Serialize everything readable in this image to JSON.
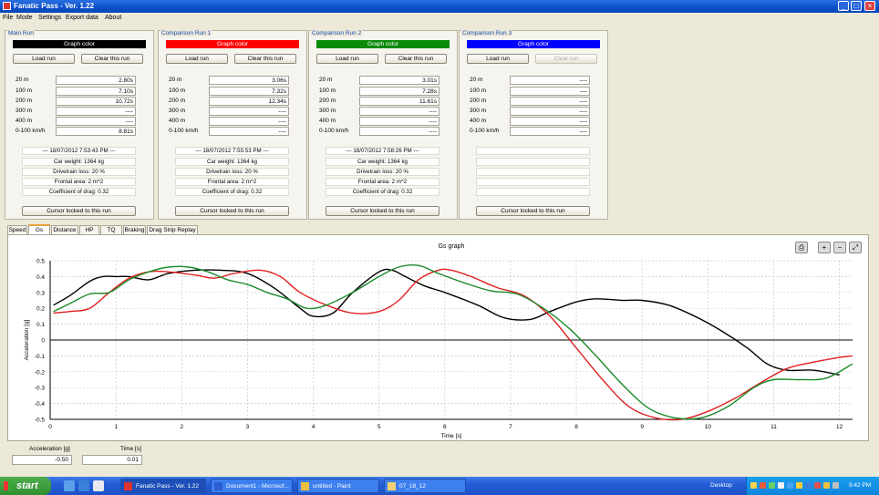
{
  "window": {
    "title": "Fanatic Pass - Ver. 1.22"
  },
  "menu": [
    "File",
    "Mode",
    "Settings",
    "Export data",
    "About"
  ],
  "row_labels": [
    "20 m",
    "100 m",
    "200 m",
    "300 m",
    "400 m",
    "0-100 km/h"
  ],
  "panels": [
    {
      "title": "Main Run",
      "color_label": "Graph color",
      "color": "#000000",
      "load_label": "Load run",
      "clear_label": "Clear this run",
      "clear_enabled": true,
      "values": [
        "2.80s",
        "7.10s",
        "10.72s",
        "----",
        "----",
        "8.81s"
      ],
      "info": [
        "--- 18/07/2012 7:53:43 PM ---",
        "Car weight: 1364 kg",
        "Drivetrain loss: 20 %",
        "Frontal area: 2 m^2",
        "Coefficient of drag: 0.32"
      ],
      "cursor_label": "Cursor locked to this run"
    },
    {
      "title": "Comparison Run 1",
      "color_label": "Graph color",
      "color": "#ff0000",
      "load_label": "Load run",
      "clear_label": "Clear this run",
      "clear_enabled": true,
      "values": [
        "3.06s",
        "7.32s",
        "12.34s",
        "----",
        "----",
        "----"
      ],
      "info": [
        "--- 18/07/2012 7:55:53 PM ---",
        "Car weight: 1364 kg",
        "Drivetrain loss: 20 %",
        "Frontal area: 2 m^2",
        "Coefficient of drag: 0.32"
      ],
      "cursor_label": "Cursor locked to this run"
    },
    {
      "title": "Comparison Run 2",
      "color_label": "Graph color",
      "color": "#0a8a0a",
      "load_label": "Load run",
      "clear_label": "Clear this run",
      "clear_enabled": true,
      "values": [
        "3.01s",
        "7.28s",
        "11.61s",
        "----",
        "----",
        "----"
      ],
      "info": [
        "--- 18/07/2012 7:58:26 PM ---",
        "Car weight: 1364 kg",
        "Drivetrain loss: 20 %",
        "Frontal area: 2 m^2",
        "Coefficient of drag: 0.32"
      ],
      "cursor_label": "Cursor locked to this run"
    },
    {
      "title": "Comparison Run 3",
      "color_label": "Graph color",
      "color": "#0000ff",
      "load_label": "Load run",
      "clear_label": "Clear run",
      "clear_enabled": false,
      "values": [
        "----",
        "----",
        "----",
        "----",
        "----",
        "----"
      ],
      "info": [
        "",
        "",
        "",
        "",
        ""
      ],
      "cursor_label": "Cursor locked to this run"
    }
  ],
  "tabs": [
    {
      "label": "Speed",
      "active": false
    },
    {
      "label": "Gs",
      "active": true
    },
    {
      "label": "Distance",
      "active": false
    },
    {
      "label": "HP",
      "active": false
    },
    {
      "label": "TQ",
      "active": false
    },
    {
      "label": "Braking",
      "active": false
    },
    {
      "label": "Drag Strip Replay",
      "active": false
    }
  ],
  "chart_data": {
    "type": "line",
    "title": "Gs graph",
    "xlabel": "Time [s]",
    "ylabel": "Acceleration [g]",
    "xlim": [
      0,
      12.2
    ],
    "ylim": [
      -0.5,
      0.5
    ],
    "x_ticks": [
      0,
      1,
      2,
      3,
      4,
      5,
      6,
      7,
      8,
      9,
      10,
      11,
      12
    ],
    "y_ticks": [
      0.5,
      0.4,
      0.3,
      0.2,
      0.1,
      0,
      -0.1,
      -0.2,
      -0.3,
      -0.4,
      -0.5
    ],
    "grid": true,
    "series": [
      {
        "color": "#000000",
        "points": [
          [
            0.05,
            0.22
          ],
          [
            0.3,
            0.28
          ],
          [
            0.6,
            0.37
          ],
          [
            0.8,
            0.4
          ],
          [
            1.0,
            0.4
          ],
          [
            1.2,
            0.4
          ],
          [
            1.5,
            0.38
          ],
          [
            1.8,
            0.42
          ],
          [
            2.2,
            0.44
          ],
          [
            2.6,
            0.44
          ],
          [
            3.0,
            0.42
          ],
          [
            3.4,
            0.33
          ],
          [
            3.8,
            0.2
          ],
          [
            4.0,
            0.15
          ],
          [
            4.3,
            0.17
          ],
          [
            4.6,
            0.3
          ],
          [
            5.0,
            0.43
          ],
          [
            5.2,
            0.44
          ],
          [
            5.4,
            0.4
          ],
          [
            5.7,
            0.34
          ],
          [
            6.0,
            0.3
          ],
          [
            6.5,
            0.22
          ],
          [
            6.9,
            0.14
          ],
          [
            7.3,
            0.13
          ],
          [
            7.6,
            0.18
          ],
          [
            8.0,
            0.24
          ],
          [
            8.3,
            0.26
          ],
          [
            8.7,
            0.25
          ],
          [
            9.0,
            0.25
          ],
          [
            9.4,
            0.22
          ],
          [
            9.8,
            0.15
          ],
          [
            10.2,
            0.06
          ],
          [
            10.6,
            -0.05
          ],
          [
            10.9,
            -0.15
          ],
          [
            11.2,
            -0.19
          ],
          [
            11.6,
            -0.19
          ],
          [
            12.0,
            -0.22
          ]
        ]
      },
      {
        "color": "#e02020",
        "points": [
          [
            0.05,
            0.17
          ],
          [
            0.3,
            0.18
          ],
          [
            0.6,
            0.2
          ],
          [
            0.9,
            0.3
          ],
          [
            1.2,
            0.39
          ],
          [
            1.5,
            0.43
          ],
          [
            1.8,
            0.43
          ],
          [
            2.2,
            0.41
          ],
          [
            2.5,
            0.39
          ],
          [
            2.8,
            0.42
          ],
          [
            3.2,
            0.44
          ],
          [
            3.5,
            0.4
          ],
          [
            3.8,
            0.3
          ],
          [
            4.2,
            0.22
          ],
          [
            4.6,
            0.17
          ],
          [
            5.0,
            0.18
          ],
          [
            5.3,
            0.25
          ],
          [
            5.6,
            0.38
          ],
          [
            5.9,
            0.44
          ],
          [
            6.1,
            0.44
          ],
          [
            6.4,
            0.4
          ],
          [
            6.8,
            0.33
          ],
          [
            7.2,
            0.28
          ],
          [
            7.6,
            0.15
          ],
          [
            8.0,
            -0.05
          ],
          [
            8.4,
            -0.25
          ],
          [
            8.8,
            -0.42
          ],
          [
            9.2,
            -0.49
          ],
          [
            9.6,
            -0.5
          ],
          [
            10.0,
            -0.45
          ],
          [
            10.4,
            -0.37
          ],
          [
            10.8,
            -0.27
          ],
          [
            11.2,
            -0.18
          ],
          [
            11.6,
            -0.14
          ],
          [
            12.0,
            -0.11
          ],
          [
            12.2,
            -0.1
          ]
        ]
      },
      {
        "color": "#1a8a2a",
        "points": [
          [
            0.05,
            0.18
          ],
          [
            0.3,
            0.23
          ],
          [
            0.6,
            0.29
          ],
          [
            0.9,
            0.3
          ],
          [
            1.2,
            0.38
          ],
          [
            1.5,
            0.43
          ],
          [
            1.8,
            0.46
          ],
          [
            2.1,
            0.46
          ],
          [
            2.4,
            0.43
          ],
          [
            2.7,
            0.38
          ],
          [
            3.0,
            0.35
          ],
          [
            3.3,
            0.3
          ],
          [
            3.6,
            0.26
          ],
          [
            3.9,
            0.2
          ],
          [
            4.2,
            0.22
          ],
          [
            4.6,
            0.3
          ],
          [
            5.0,
            0.4
          ],
          [
            5.3,
            0.46
          ],
          [
            5.6,
            0.47
          ],
          [
            5.9,
            0.42
          ],
          [
            6.3,
            0.36
          ],
          [
            6.7,
            0.31
          ],
          [
            7.1,
            0.29
          ],
          [
            7.5,
            0.2
          ],
          [
            7.9,
            0.07
          ],
          [
            8.3,
            -0.1
          ],
          [
            8.7,
            -0.28
          ],
          [
            9.1,
            -0.43
          ],
          [
            9.5,
            -0.49
          ],
          [
            9.9,
            -0.49
          ],
          [
            10.3,
            -0.42
          ],
          [
            10.7,
            -0.3
          ],
          [
            11.0,
            -0.25
          ],
          [
            11.4,
            -0.25
          ],
          [
            11.8,
            -0.24
          ],
          [
            12.2,
            -0.15
          ]
        ]
      }
    ]
  },
  "chart_tools": [
    "print-icon",
    "zoom-in-icon",
    "zoom-out-icon",
    "fit-icon"
  ],
  "cursor": {
    "acc_label": "Acceleration [g]",
    "acc_value": "-0.50",
    "time_label": "Time [s]",
    "time_value": "0.01"
  },
  "taskbar": {
    "start_label": "start",
    "tasks": [
      {
        "label": "Fanatic Pass - Ver. 1.22",
        "active": true
      },
      {
        "label": "Document1 - Microsof...",
        "active": false
      },
      {
        "label": "untitled - Paint",
        "active": false
      },
      {
        "label": "07_18_12",
        "active": false
      }
    ],
    "desktop_label": "Desktop",
    "clock": "9:42 PM"
  }
}
